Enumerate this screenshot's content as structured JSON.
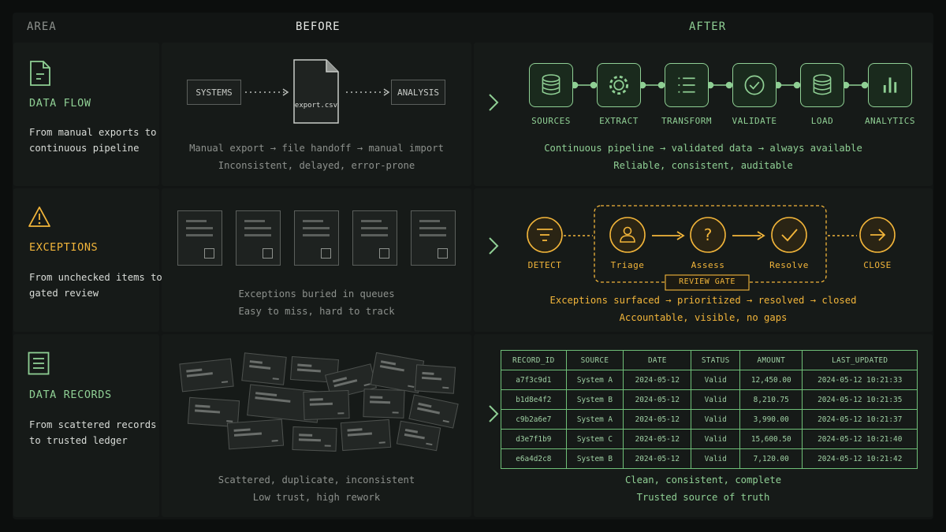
{
  "headers": {
    "area": "AREA",
    "before": "BEFORE",
    "after": "AFTER"
  },
  "colors": {
    "green": "#8fcf94",
    "amber": "#f2b53a",
    "grey": "#8d918d",
    "bg": "#0c0e0d"
  },
  "rows": {
    "dataflow": {
      "icon": "document-icon",
      "title": "DATA FLOW",
      "desc": "From manual exports to continuous pipeline",
      "before": {
        "systems": "SYSTEMS",
        "file": "export.csv",
        "analysis": "ANALYSIS",
        "caption1": "Manual export → file handoff → manual import",
        "caption2": "Inconsistent, delayed, error-prone"
      },
      "after": {
        "steps": [
          {
            "label": "SOURCES",
            "icon": "database-icon"
          },
          {
            "label": "EXTRACT",
            "icon": "gear-icon"
          },
          {
            "label": "TRANSFORM",
            "icon": "list-icon"
          },
          {
            "label": "VALIDATE",
            "icon": "check-circle-icon"
          },
          {
            "label": "LOAD",
            "icon": "database-icon"
          },
          {
            "label": "ANALYTICS",
            "icon": "bar-chart-icon"
          }
        ],
        "caption1": "Continuous pipeline → validated data → always available",
        "caption2": "Reliable, consistent, auditable"
      }
    },
    "exceptions": {
      "icon": "warning-icon",
      "title": "EXCEPTIONS",
      "desc": "From unchecked items to gated review",
      "before": {
        "caption1": "Exceptions buried in queues",
        "caption2": "Easy to miss, hard to track"
      },
      "after": {
        "detect": "DETECT",
        "triage": "Triage",
        "assess": "Assess",
        "resolve": "Resolve",
        "close": "CLOSE",
        "gate": "REVIEW GATE",
        "caption1": "Exceptions surfaced → prioritized → resolved → closed",
        "caption2": "Accountable, visible, no gaps"
      }
    },
    "records": {
      "icon": "list-document-icon",
      "title": "DATA RECORDS",
      "desc": "From scattered records to trusted ledger",
      "before": {
        "caption1": "Scattered, duplicate, inconsistent",
        "caption2": "Low trust, high rework"
      },
      "after": {
        "columns": [
          "RECORD_ID",
          "SOURCE",
          "DATE",
          "STATUS",
          "AMOUNT",
          "LAST_UPDATED"
        ],
        "rows": [
          [
            "a7f3c9d1",
            "System A",
            "2024-05-12",
            "Valid",
            "12,450.00",
            "2024-05-12 10:21:33"
          ],
          [
            "b1d8e4f2",
            "System B",
            "2024-05-12",
            "Valid",
            "8,210.75",
            "2024-05-12 10:21:35"
          ],
          [
            "c9b2a6e7",
            "System A",
            "2024-05-12",
            "Valid",
            "3,990.00",
            "2024-05-12 10:21:37"
          ],
          [
            "d3e7f1b9",
            "System C",
            "2024-05-12",
            "Valid",
            "15,600.50",
            "2024-05-12 10:21:40"
          ],
          [
            "e6a4d2c8",
            "System B",
            "2024-05-12",
            "Valid",
            "7,120.00",
            "2024-05-12 10:21:42"
          ]
        ],
        "caption1": "Clean, consistent, complete",
        "caption2": "Trusted source of truth"
      }
    }
  }
}
